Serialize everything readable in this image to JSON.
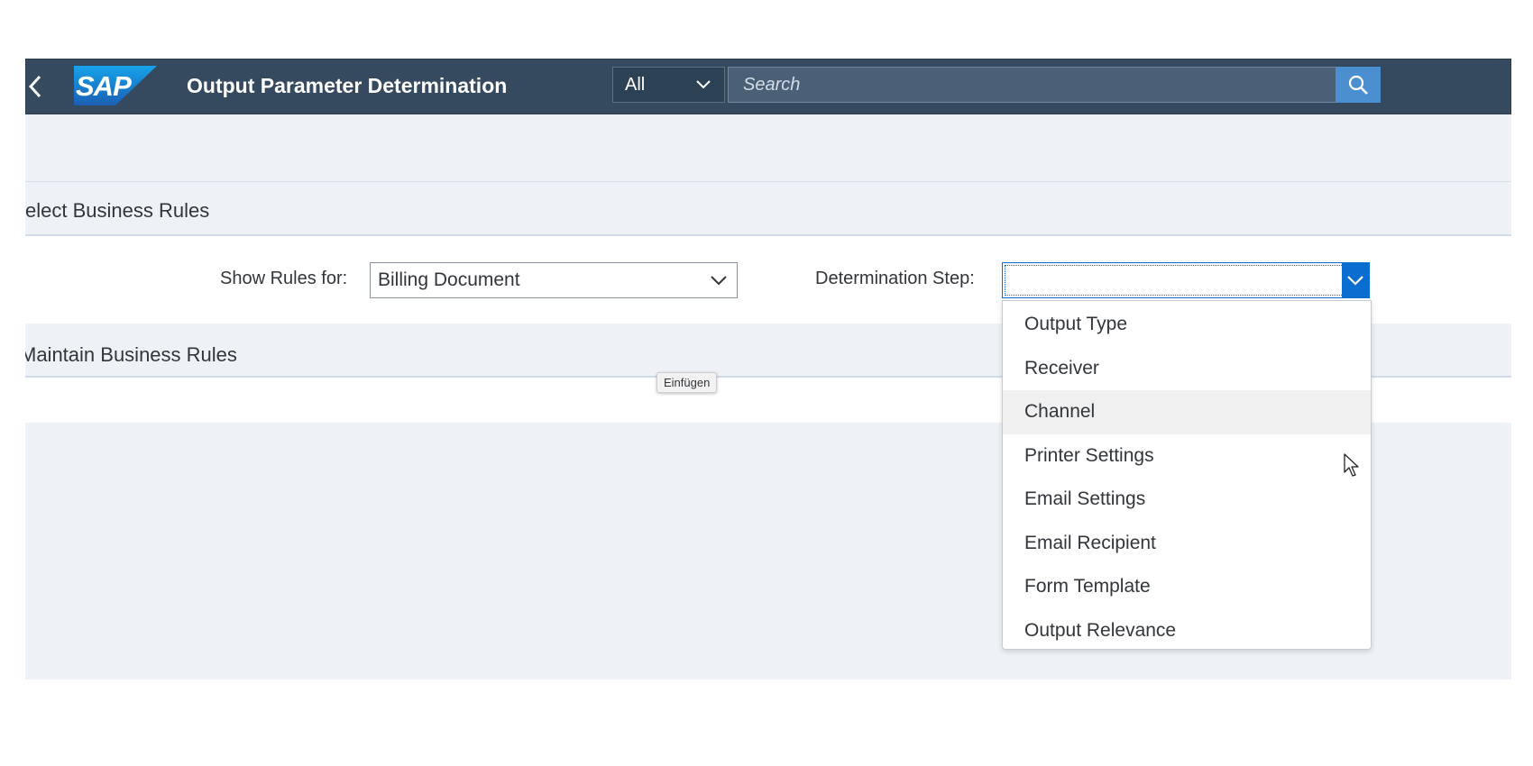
{
  "shell": {
    "logo_text": "SAP",
    "title": "Output Parameter Determination",
    "search_scope": "All",
    "search_placeholder": "Search",
    "icons": [
      "back-arrow-icon",
      "chevron-down-icon",
      "search-icon"
    ]
  },
  "sections": {
    "select_title": "elect Business Rules",
    "maintain_title": "Maintain Business Rules"
  },
  "filters": {
    "show_rules_label": "Show Rules for:",
    "show_rules_value": "Billing Document",
    "determination_step_label": "Determination Step:",
    "determination_step_value": ""
  },
  "dropdown": {
    "items": [
      {
        "label": "Output Type"
      },
      {
        "label": "Receiver"
      },
      {
        "label": "Channel",
        "hovered": true
      },
      {
        "label": "Printer Settings"
      },
      {
        "label": "Email Settings"
      },
      {
        "label": "Email Recipient"
      },
      {
        "label": "Form Template"
      },
      {
        "label": "Output Relevance"
      }
    ]
  },
  "tooltip": {
    "text": "Einfügen"
  },
  "colors": {
    "shell_bg": "#354a5f",
    "accent": "#0a6ed1",
    "search_button": "#4b8fd0",
    "logo_blue": "#1a73d1",
    "page_bg": "#eef2f6"
  }
}
